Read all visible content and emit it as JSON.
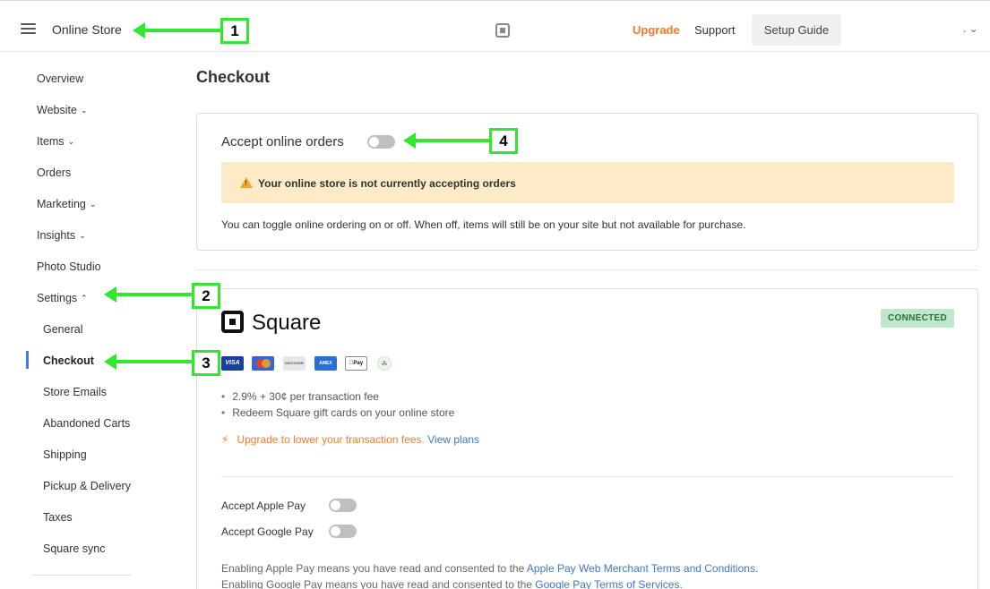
{
  "topbar": {
    "store_title": "Online Store",
    "upgrade": "Upgrade",
    "support": "Support",
    "setup_guide": "Setup Guide",
    "user_menu": ". ⌄"
  },
  "sidebar": {
    "items": [
      {
        "label": "Overview"
      },
      {
        "label": "Website",
        "chevron": "⌄"
      },
      {
        "label": "Items",
        "chevron": "⌄"
      },
      {
        "label": "Orders"
      },
      {
        "label": "Marketing",
        "chevron": "⌄"
      },
      {
        "label": "Insights",
        "chevron": "⌄"
      },
      {
        "label": "Photo Studio"
      },
      {
        "label": "Settings",
        "chevron": "⌃"
      }
    ],
    "settings_sub": [
      {
        "label": "General"
      },
      {
        "label": "Checkout",
        "active": true
      },
      {
        "label": "Store Emails"
      },
      {
        "label": "Abandoned Carts"
      },
      {
        "label": "Shipping"
      },
      {
        "label": "Pickup & Delivery"
      },
      {
        "label": "Taxes"
      },
      {
        "label": "Square sync"
      }
    ]
  },
  "main": {
    "page_title": "Checkout",
    "online_orders": {
      "label": "Accept online orders",
      "enabled": false,
      "warning": "Your online store is not currently accepting orders",
      "help": "You can toggle online ordering on or off. When off, items will still be on your site but not available for purchase."
    },
    "square": {
      "brand": "Square",
      "status_badge": "CONNECTED",
      "payment_cards": {
        "visa": "VISA",
        "mastercard": "",
        "discover": "DISCOVER",
        "amex": "AMEX",
        "apple_pay": "Pay",
        "gift": "☘"
      },
      "bullets": [
        "2.9% + 30¢ per transaction fee",
        "Redeem Square gift cards on your online store"
      ],
      "upgrade_note": "Upgrade to lower your transaction fees.",
      "view_plans": "View plans",
      "apple_pay_label": "Accept Apple Pay",
      "google_pay_label": "Accept Google Pay",
      "apple_pay_enabled": false,
      "google_pay_enabled": false,
      "terms_apple_prefix": "Enabling Apple Pay means you have read and consented to the",
      "terms_apple_link": "Apple Pay Web Merchant Terms and Conditions",
      "terms_google_prefix": "Enabling Google Pay means you have read and consented to the",
      "terms_google_link": "Google Pay Terms of Services"
    }
  },
  "annotations": [
    "1",
    "2",
    "3",
    "4"
  ],
  "colors": {
    "accent_orange": "#f07b2c",
    "link_blue": "#3f76c9",
    "warning_bg": "#fcebc6",
    "badge_green": "#bfe7c9",
    "annotation_green": "#32e632",
    "active_indicator": "#3e7be6"
  }
}
